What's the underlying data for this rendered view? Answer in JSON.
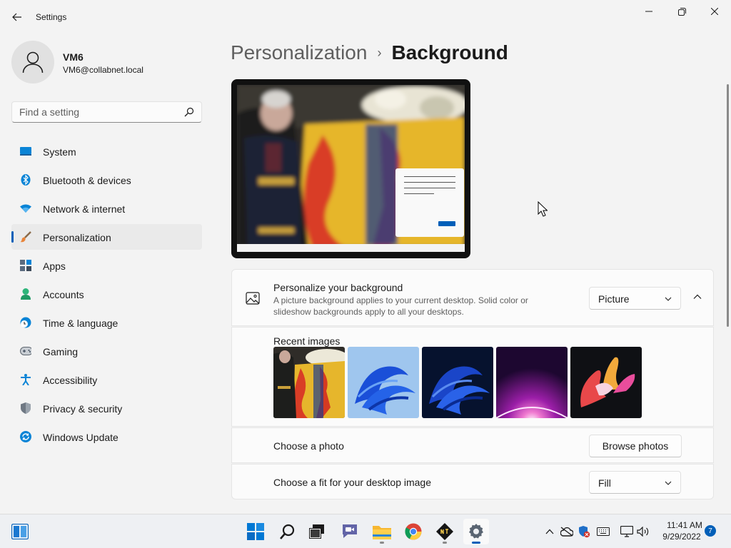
{
  "window": {
    "title": "Settings",
    "back_icon": "back-arrow-icon",
    "controls": [
      "minimize-icon",
      "maximize-icon",
      "close-icon"
    ]
  },
  "user": {
    "name": "VM6",
    "email": "VM6@collabnet.local"
  },
  "search": {
    "placeholder": "Find a setting"
  },
  "sidebar": {
    "items": [
      {
        "label": "System",
        "icon": "system-icon"
      },
      {
        "label": "Bluetooth & devices",
        "icon": "bluetooth-icon"
      },
      {
        "label": "Network & internet",
        "icon": "wifi-icon"
      },
      {
        "label": "Personalization",
        "icon": "paintbrush-icon",
        "active": true
      },
      {
        "label": "Apps",
        "icon": "apps-icon"
      },
      {
        "label": "Accounts",
        "icon": "accounts-icon"
      },
      {
        "label": "Time & language",
        "icon": "clock-globe-icon"
      },
      {
        "label": "Gaming",
        "icon": "gamepad-icon"
      },
      {
        "label": "Accessibility",
        "icon": "accessibility-icon"
      },
      {
        "label": "Privacy & security",
        "icon": "shield-icon"
      },
      {
        "label": "Windows Update",
        "icon": "update-icon"
      }
    ]
  },
  "breadcrumb": {
    "parent": "Personalization",
    "separator": "›",
    "current": "Background"
  },
  "background": {
    "title": "Personalize your background",
    "description": "A picture background applies to your current desktop. Solid color or slideshow backgrounds apply to all your desktops.",
    "type_value": "Picture",
    "recent_label": "Recent images",
    "choose_photo_label": "Choose a photo",
    "browse_label": "Browse photos",
    "fit_label": "Choose a fit for your desktop image",
    "fit_value": "Fill"
  },
  "taskbar": {
    "apps": [
      "widgets-icon",
      "start-icon",
      "search-icon",
      "task-view-icon",
      "teams-chat-icon",
      "file-explorer-icon",
      "chrome-icon",
      "terminal-app-icon",
      "settings-icon"
    ],
    "tray": [
      "chevron-up-icon",
      "onedrive-offline-icon",
      "defender-icon",
      "keyboard-icon",
      "network-icon",
      "volume-icon"
    ],
    "time": "11:41 AM",
    "date": "9/29/2022",
    "notification_count": "7"
  },
  "colors": {
    "accent": "#005fb8",
    "background": "#f3f3f3",
    "card": "#fbfbfb"
  }
}
